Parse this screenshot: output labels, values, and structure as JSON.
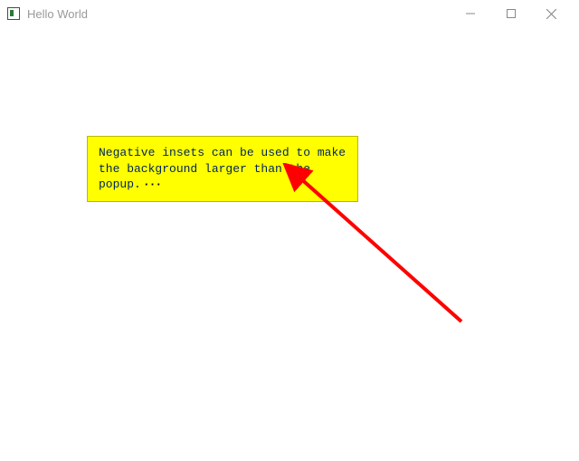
{
  "window": {
    "title": "Hello World"
  },
  "popup": {
    "text": "Negative insets can be used to make the background larger than the popup.",
    "ellipsis": "···"
  },
  "colors": {
    "highlight": "#ffff00",
    "arrow": "#ff0000"
  }
}
